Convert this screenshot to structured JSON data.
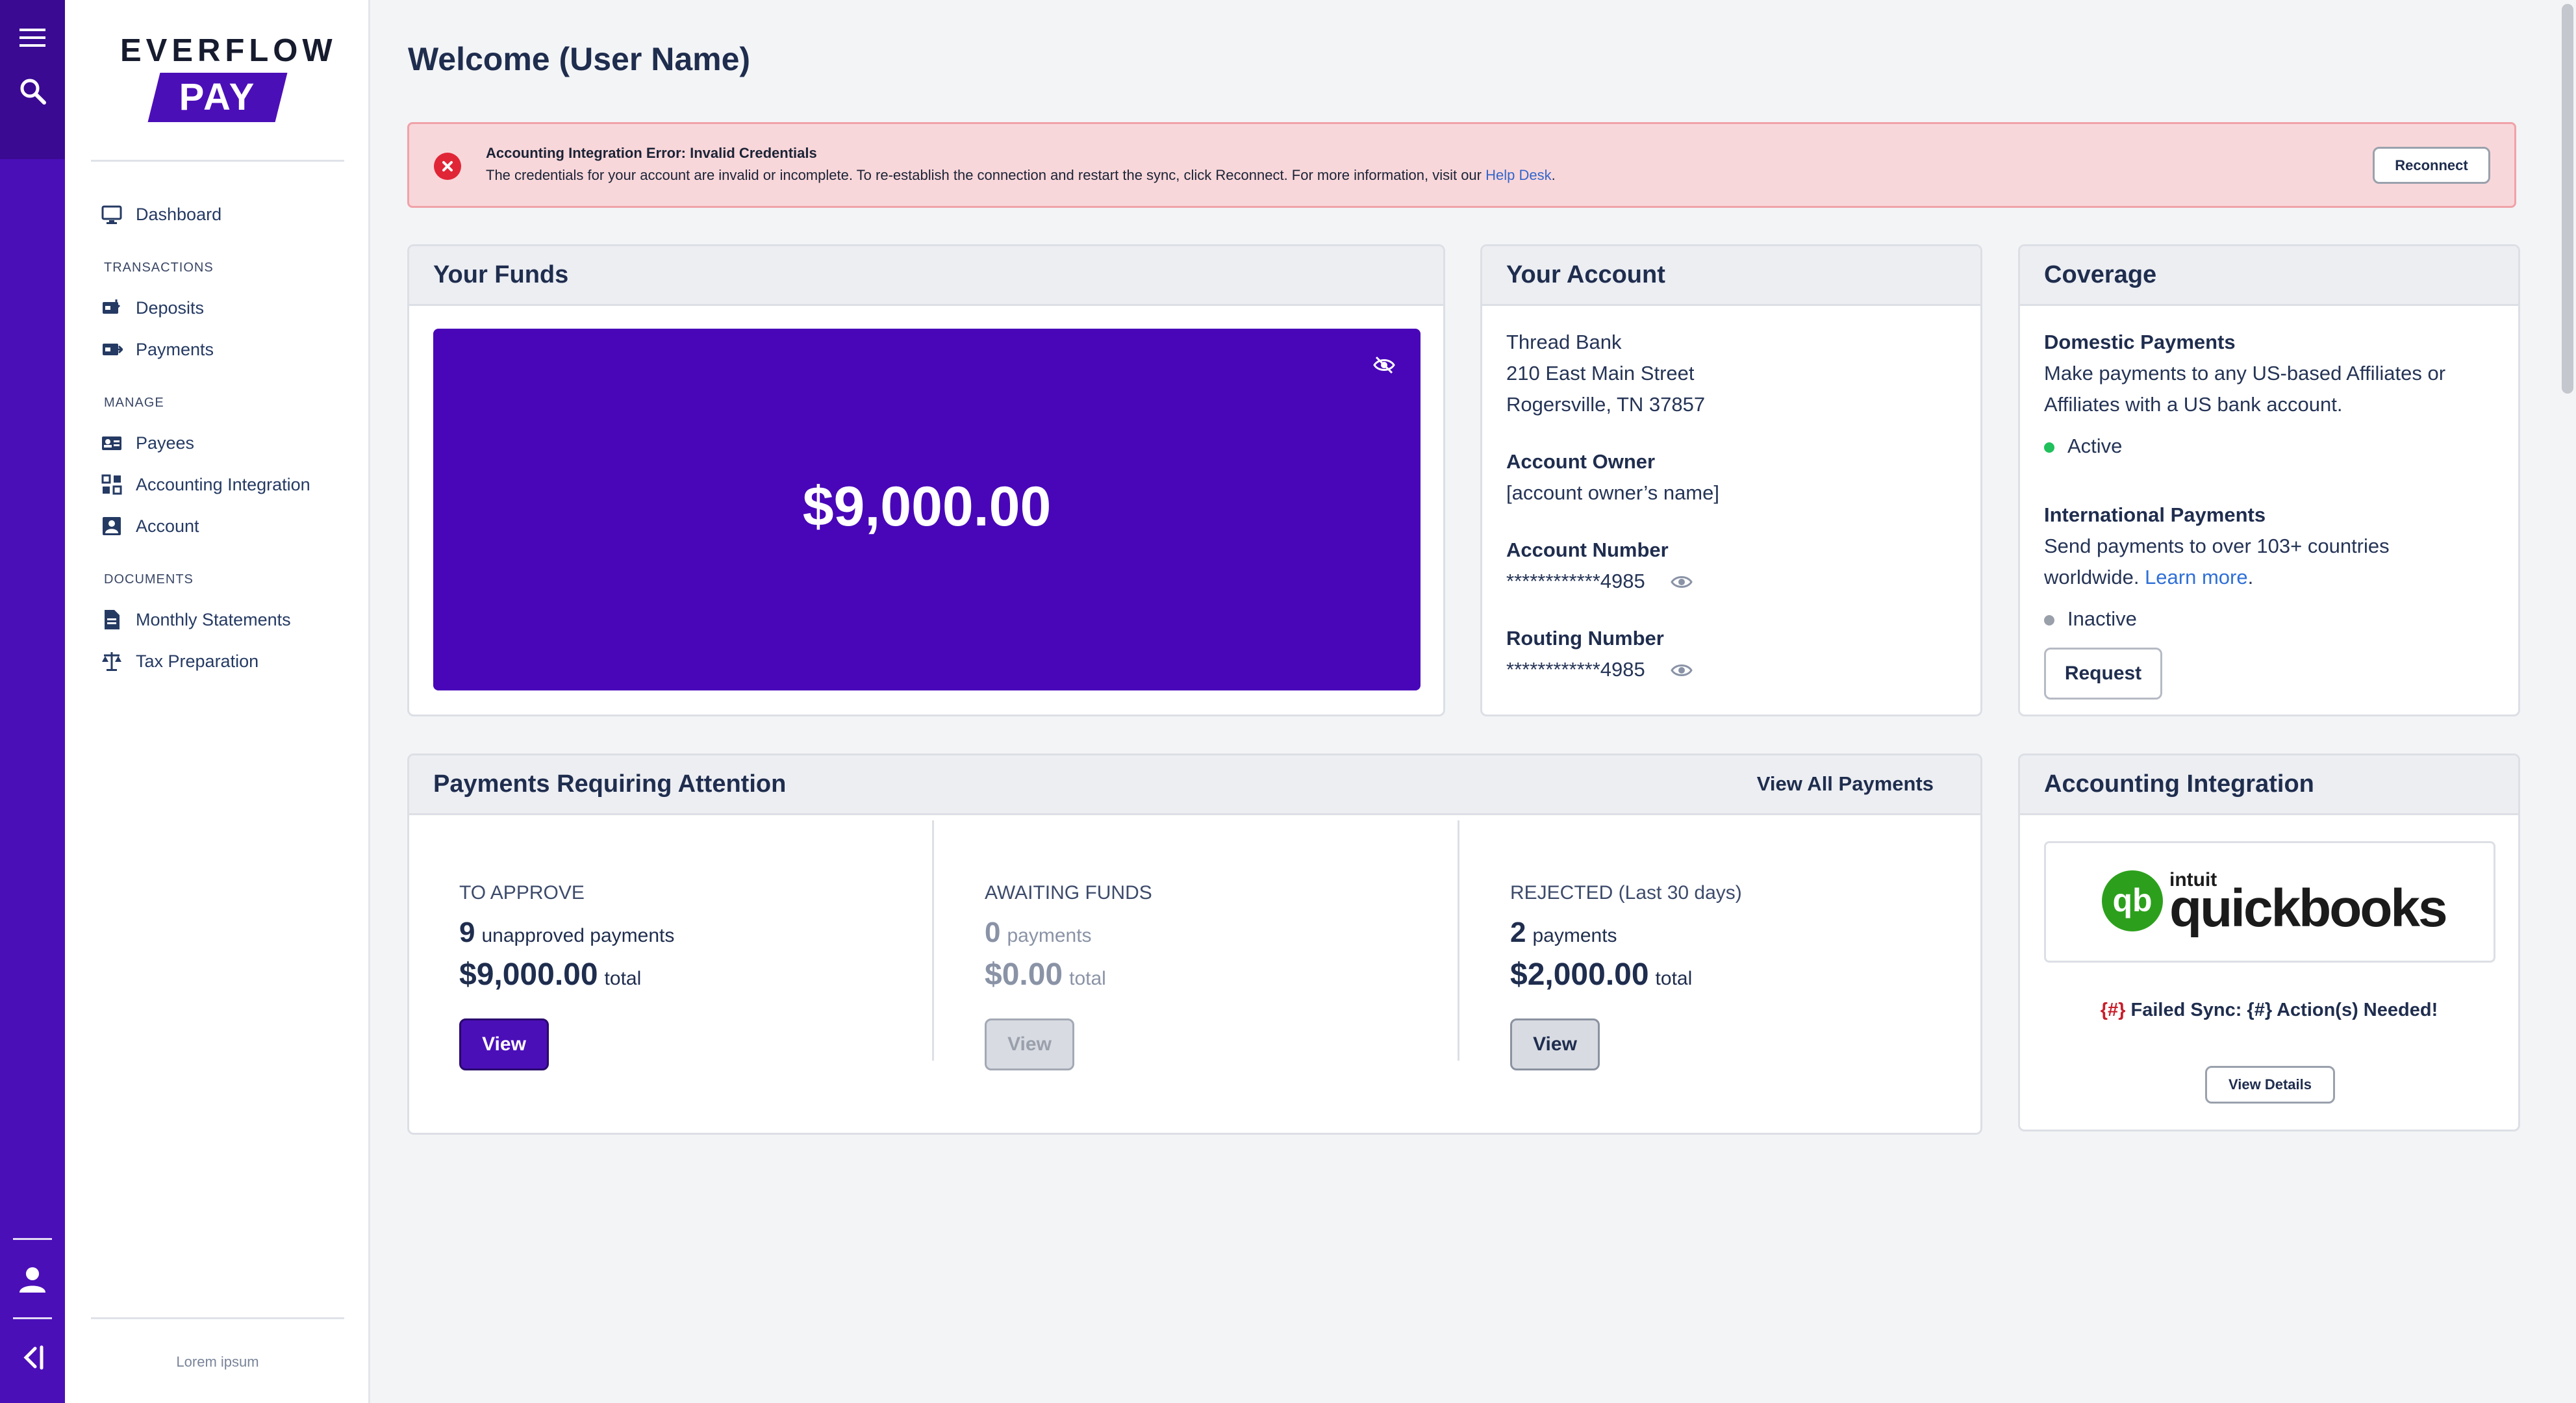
{
  "brand": {
    "top": "EVERFLOW",
    "pay": "PAY"
  },
  "colors": {
    "brand": "#4b0fb8",
    "funds": "#4806b8",
    "error": "#e02636",
    "active": "#20c05c",
    "inactive": "#9aa0aa",
    "qb_green": "#2ca01c"
  },
  "sidebar": {
    "dashboard": "Dashboard",
    "sections": {
      "transactions": "TRANSACTIONS",
      "manage": "MANAGE",
      "documents": "DOCUMENTS"
    },
    "deposits": "Deposits",
    "payments": "Payments",
    "payees": "Payees",
    "accounting": "Accounting Integration",
    "account": "Account",
    "statements": "Monthly Statements",
    "tax": "Tax Preparation",
    "footer": "Lorem ipsum"
  },
  "welcome": "Welcome (User Name)",
  "alert": {
    "title": "Accounting Integration Error: Invalid Credentials",
    "body": "The credentials for your account are invalid or incomplete. To re-establish the connection and restart the sync, click Reconnect. For more information, visit our ",
    "link": "Help Desk",
    "end": ".",
    "button": "Reconnect"
  },
  "funds": {
    "title": "Your Funds",
    "amount": "$9,000.00"
  },
  "account": {
    "title": "Your Account",
    "bank": "Thread Bank",
    "address1": "210 East Main Street",
    "address2": "Rogersville, TN 37857",
    "owner_label": "Account Owner",
    "owner_value": "[account owner’s name]",
    "number_label": "Account Number",
    "number_value": "************4985",
    "routing_label": "Routing Number",
    "routing_value": "************4985"
  },
  "coverage": {
    "title": "Coverage",
    "domestic_title": "Domestic Payments",
    "domestic_line1": "Make payments to any US-based Affiliates or",
    "domestic_line2": "Affiliates with a US bank account.",
    "domestic_status": "Active",
    "intl_title": "International Payments",
    "intl_line1": "Send payments to over 103+ countries",
    "intl_line2": "worldwide. ",
    "intl_link": "Learn more",
    "intl_end": ".",
    "intl_status": "Inactive",
    "request": "Request"
  },
  "attention": {
    "title": "Payments Requiring Attention",
    "view_all": "View All Payments",
    "approve": {
      "title": "TO APPROVE",
      "count": "9",
      "unit": "unapproved payments",
      "amount": "$9,000.00",
      "total": "total",
      "button": "View"
    },
    "awaiting": {
      "title": "AWAITING FUNDS",
      "count": "0",
      "unit": "payments",
      "amount": "$0.00",
      "total": "total",
      "button": "View"
    },
    "rejected": {
      "title": "REJECTED (Last 30 days)",
      "count": "2",
      "unit": "payments",
      "amount": "$2,000.00",
      "total": "total",
      "button": "View"
    }
  },
  "integration": {
    "title": "Accounting Integration",
    "logo_top": "intuit",
    "logo_main": "quickbooks",
    "sync_prefix": "{#}",
    "sync_text": " Failed Sync: {#} Action(s) Needed!",
    "details": "View Details"
  }
}
